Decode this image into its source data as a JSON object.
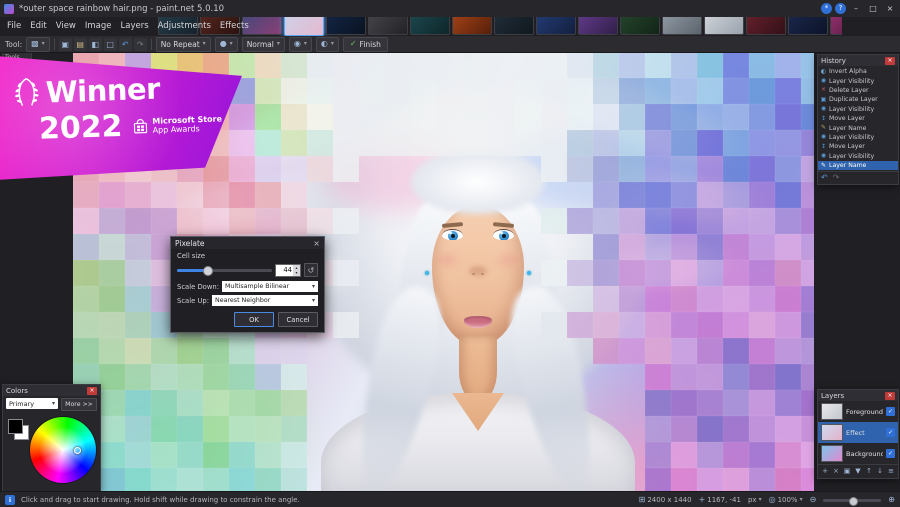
{
  "window": {
    "title": "*outer space rainbow hair.png - paint.net 5.0.10"
  },
  "ui": {
    "caret": "▾",
    "spinner_up": "▴",
    "spinner_down": "▾"
  },
  "titlebar": {
    "settings_glyph": "*",
    "help_glyph": "?",
    "minimize_glyph": "–",
    "maximize_glyph": "□",
    "close_glyph": "×"
  },
  "menu": {
    "items": [
      "File",
      "Edit",
      "View",
      "Image",
      "Layers",
      "Adjustments",
      "Effects"
    ]
  },
  "thumbnails": {
    "active_index": 3,
    "items": [
      {
        "c1": "#27404e",
        "c2": "#16222c"
      },
      {
        "c1": "#5d2a22",
        "c2": "#2a120e"
      },
      {
        "c1": "#394a7e",
        "c2": "#8a3f74"
      },
      {
        "c1": "#c9d6ee",
        "c2": "#e5b9cf"
      },
      {
        "c1": "#14284a",
        "c2": "#0a1322"
      },
      {
        "c1": "#4a4a50",
        "c2": "#232327"
      },
      {
        "c1": "#1d4e55",
        "c2": "#0e2629"
      },
      {
        "c1": "#b0491a",
        "c2": "#571f0a"
      },
      {
        "c1": "#23303c",
        "c2": "#11181f"
      },
      {
        "c1": "#27417e",
        "c2": "#121f3e"
      },
      {
        "c1": "#6a3f96",
        "c2": "#31204a"
      },
      {
        "c1": "#274a30",
        "c2": "#122416"
      },
      {
        "c1": "#9aa4ae",
        "c2": "#5b636c"
      },
      {
        "c1": "#d9dde2",
        "c2": "#9aa2ac"
      },
      {
        "c1": "#6e2430",
        "c2": "#331018"
      },
      {
        "c1": "#1c2a52",
        "c2": "#0d1429"
      },
      {
        "c1": "#a03478",
        "c2": "#4a1738"
      }
    ]
  },
  "toolbar": {
    "tool_label": "Tool:",
    "active_tool_glyph": "▩",
    "icons": [
      {
        "name": "copy-icon",
        "glyph": "▣",
        "color": "#9fb6d4"
      },
      {
        "name": "paste-icon",
        "glyph": "▤",
        "color": "#c8b47e"
      },
      {
        "name": "crop-icon",
        "glyph": "◧",
        "color": "#9fb6d4"
      },
      {
        "name": "deselect-icon",
        "glyph": "□",
        "color": "#9fb6d4"
      },
      {
        "name": "undo-icon",
        "glyph": "↶",
        "color": "#5b9bd5"
      },
      {
        "name": "redo-icon",
        "glyph": "↷",
        "color": "#777e88"
      }
    ],
    "repeat_mode": "No Repeat",
    "brush_glyph": "●",
    "blend_mode": "Normal",
    "antialias_glyph": "◉",
    "quality_glyph": "◐",
    "finish_check": "✓",
    "finish_label": "Finish"
  },
  "tools_panel": {
    "title": "Tools",
    "icons": [
      {
        "name": "rectangle-select-icon",
        "glyph": "▭"
      },
      {
        "name": "lasso-select-icon",
        "glyph": "◌"
      },
      {
        "name": "ellipse-select-icon",
        "glyph": "○"
      },
      {
        "name": "magic-wand-icon",
        "glyph": "☆"
      },
      {
        "name": "move-selection-icon",
        "glyph": "+"
      },
      {
        "name": "zoom-icon",
        "glyph": "◎"
      },
      {
        "name": "pan-icon",
        "glyph": "↔"
      },
      {
        "name": "paint-bucket-icon",
        "glyph": "◧"
      },
      {
        "name": "gradient-icon",
        "glyph": "▩"
      },
      {
        "name": "paintbrush-icon",
        "glyph": "✎"
      },
      {
        "name": "eraser-icon",
        "glyph": "▰"
      },
      {
        "name": "pencil-icon",
        "glyph": "╱"
      },
      {
        "name": "color-picker-icon",
        "glyph": "◉"
      },
      {
        "name": "clone-stamp-icon",
        "glyph": "▣"
      },
      {
        "name": "text-icon",
        "glyph": "T"
      },
      {
        "name": "shapes-icon",
        "glyph": "◆"
      }
    ]
  },
  "badge": {
    "winner": "Winner",
    "year": "2022",
    "store_line1": "Microsoft Store",
    "store_line2": "App Awards"
  },
  "dialog": {
    "title": "Pixelate",
    "close_glyph": "×",
    "cell_size_label": "Cell size",
    "cell_size_value": "44",
    "reset_glyph": "↺",
    "scale_down_label": "Scale Down:",
    "scale_down_value": "Multisample Bilinear",
    "scale_up_label": "Scale Up:",
    "scale_up_value": "Nearest Neighbor",
    "ok_label": "OK",
    "cancel_label": "Cancel"
  },
  "history": {
    "title": "History",
    "close_glyph": "×",
    "selected_index": 10,
    "undo_glyph": "↶",
    "redo_glyph": "↷",
    "items": [
      {
        "label": "Invert Alpha",
        "icon": "invert-alpha-icon",
        "glyph": "◐",
        "color": "#7ab0d8"
      },
      {
        "label": "Layer Visibility",
        "icon": "layer-visibility-icon",
        "glyph": "◉",
        "color": "#5b9bd5"
      },
      {
        "label": "Delete Layer",
        "icon": "delete-layer-icon",
        "glyph": "×",
        "color": "#d06060"
      },
      {
        "label": "Duplicate Layer",
        "icon": "duplicate-layer-icon",
        "glyph": "▣",
        "color": "#5b9bd5"
      },
      {
        "label": "Layer Visibility",
        "icon": "layer-visibility-icon",
        "glyph": "◉",
        "color": "#5b9bd5"
      },
      {
        "label": "Move Layer",
        "icon": "move-layer-icon",
        "glyph": "↕",
        "color": "#5b9bd5"
      },
      {
        "label": "Layer Name",
        "icon": "rename-layer-icon",
        "glyph": "✎",
        "color": "#b8a86a"
      },
      {
        "label": "Layer Visibility",
        "icon": "layer-visibility-icon",
        "glyph": "◉",
        "color": "#5b9bd5"
      },
      {
        "label": "Move Layer",
        "icon": "move-layer-icon",
        "glyph": "↕",
        "color": "#5b9bd5"
      },
      {
        "label": "Layer Visibility",
        "icon": "layer-visibility-icon",
        "glyph": "◉",
        "color": "#5b9bd5"
      },
      {
        "label": "Layer Name",
        "icon": "rename-layer-icon",
        "glyph": "✎",
        "color": "#ffffff"
      }
    ]
  },
  "colors_panel": {
    "title": "Colors",
    "close_glyph": "×",
    "primary_label": "Primary",
    "more_label": "More >>"
  },
  "layers_panel": {
    "title": "Layers",
    "close_glyph": "×",
    "check_glyph": "✓",
    "items": [
      {
        "name": "Foreground",
        "checked": true,
        "selected": false,
        "c1": "#e8e8ec",
        "c2": "#c2c6cc"
      },
      {
        "name": "Effect",
        "checked": true,
        "selected": true,
        "c1": "#cfd9ee",
        "c2": "#e2b3cb"
      },
      {
        "name": "Background",
        "checked": true,
        "selected": false,
        "c1": "#7fc3ea",
        "c2": "#e08ad0"
      }
    ],
    "footer_icons": [
      {
        "name": "add-layer-icon",
        "glyph": "+"
      },
      {
        "name": "delete-layer-icon",
        "glyph": "×"
      },
      {
        "name": "duplicate-layer-icon",
        "glyph": "▣"
      },
      {
        "name": "merge-down-icon",
        "glyph": "▼"
      },
      {
        "name": "move-layer-up-icon",
        "glyph": "↑"
      },
      {
        "name": "move-layer-down-icon",
        "glyph": "↓"
      },
      {
        "name": "layer-properties-icon",
        "glyph": "≡"
      }
    ]
  },
  "statusbar": {
    "info_glyph": "i",
    "hint": "Click and drag to start drawing. Hold shift while drawing to constrain the angle.",
    "size_icon": "⊞",
    "image_size": "2400 x 1440",
    "pos_icon": "+",
    "cursor_position": "1167, -41",
    "unit": "px",
    "zoom_icon": "◎",
    "zoom": "100%",
    "zoom_out_glyph": "⊖",
    "zoom_in_glyph": "⊕"
  }
}
